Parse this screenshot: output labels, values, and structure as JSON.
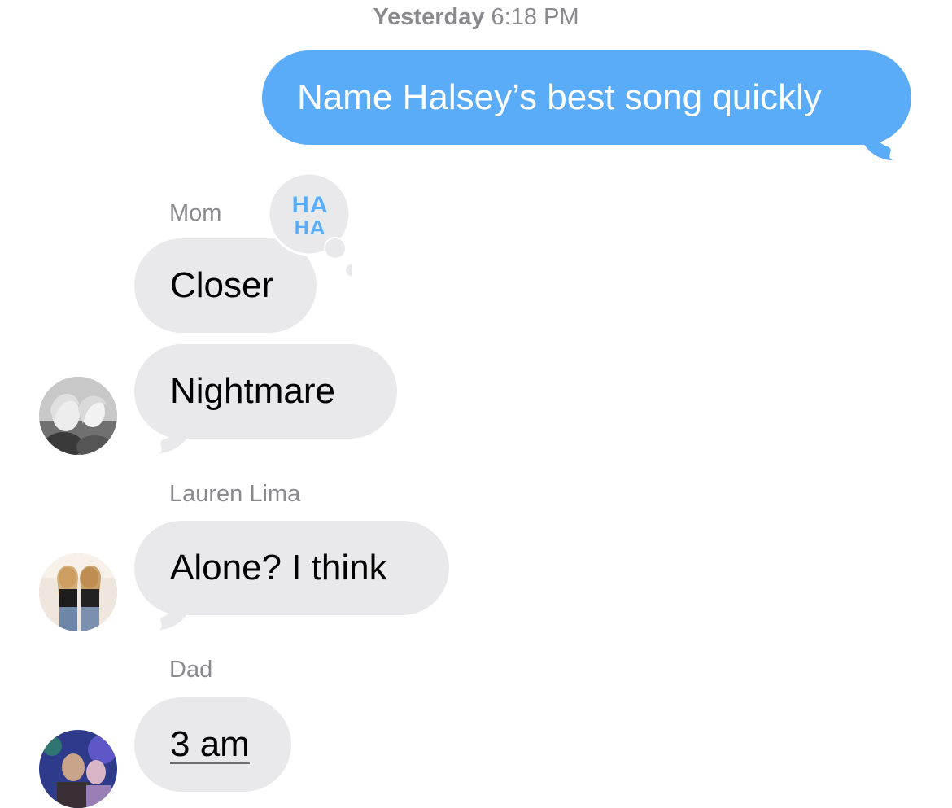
{
  "conversation": {
    "timestamp": {
      "day": "Yesterday",
      "time": "6:18 PM"
    },
    "messages": [
      {
        "direction": "outgoing",
        "text": "Name Halsey’s best song quickly"
      },
      {
        "direction": "incoming",
        "sender": "Mom",
        "text": "Closer",
        "tapback": "HA HA"
      },
      {
        "direction": "incoming",
        "sender": "Mom",
        "text": "Nightmare"
      },
      {
        "direction": "incoming",
        "sender": "Lauren Lima",
        "text": "Alone? I think"
      },
      {
        "direction": "incoming",
        "sender": "Dad",
        "text": "3 am"
      }
    ],
    "tapback_icon": "haha-icon"
  },
  "colors": {
    "outgoing_bubble": "#5aacf8",
    "incoming_bubble": "#e9e9eb",
    "meta_text": "#8a8a8e",
    "tapback_glyph": "#5aacf8"
  }
}
